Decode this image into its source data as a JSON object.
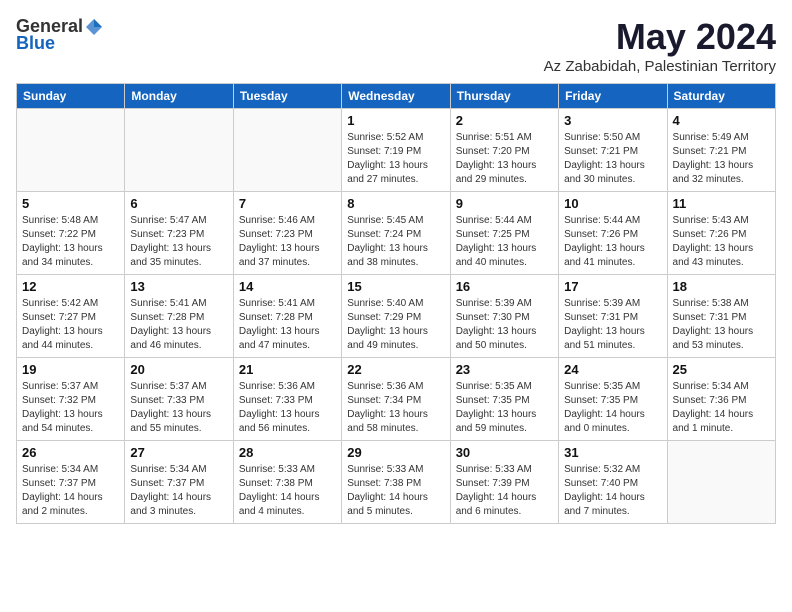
{
  "header": {
    "logo_general": "General",
    "logo_blue": "Blue",
    "month_title": "May 2024",
    "location": "Az Zababidah, Palestinian Territory"
  },
  "days_of_week": [
    "Sunday",
    "Monday",
    "Tuesday",
    "Wednesday",
    "Thursday",
    "Friday",
    "Saturday"
  ],
  "weeks": [
    [
      {
        "day": "",
        "info": ""
      },
      {
        "day": "",
        "info": ""
      },
      {
        "day": "",
        "info": ""
      },
      {
        "day": "1",
        "info": "Sunrise: 5:52 AM\nSunset: 7:19 PM\nDaylight: 13 hours\nand 27 minutes."
      },
      {
        "day": "2",
        "info": "Sunrise: 5:51 AM\nSunset: 7:20 PM\nDaylight: 13 hours\nand 29 minutes."
      },
      {
        "day": "3",
        "info": "Sunrise: 5:50 AM\nSunset: 7:21 PM\nDaylight: 13 hours\nand 30 minutes."
      },
      {
        "day": "4",
        "info": "Sunrise: 5:49 AM\nSunset: 7:21 PM\nDaylight: 13 hours\nand 32 minutes."
      }
    ],
    [
      {
        "day": "5",
        "info": "Sunrise: 5:48 AM\nSunset: 7:22 PM\nDaylight: 13 hours\nand 34 minutes."
      },
      {
        "day": "6",
        "info": "Sunrise: 5:47 AM\nSunset: 7:23 PM\nDaylight: 13 hours\nand 35 minutes."
      },
      {
        "day": "7",
        "info": "Sunrise: 5:46 AM\nSunset: 7:23 PM\nDaylight: 13 hours\nand 37 minutes."
      },
      {
        "day": "8",
        "info": "Sunrise: 5:45 AM\nSunset: 7:24 PM\nDaylight: 13 hours\nand 38 minutes."
      },
      {
        "day": "9",
        "info": "Sunrise: 5:44 AM\nSunset: 7:25 PM\nDaylight: 13 hours\nand 40 minutes."
      },
      {
        "day": "10",
        "info": "Sunrise: 5:44 AM\nSunset: 7:26 PM\nDaylight: 13 hours\nand 41 minutes."
      },
      {
        "day": "11",
        "info": "Sunrise: 5:43 AM\nSunset: 7:26 PM\nDaylight: 13 hours\nand 43 minutes."
      }
    ],
    [
      {
        "day": "12",
        "info": "Sunrise: 5:42 AM\nSunset: 7:27 PM\nDaylight: 13 hours\nand 44 minutes."
      },
      {
        "day": "13",
        "info": "Sunrise: 5:41 AM\nSunset: 7:28 PM\nDaylight: 13 hours\nand 46 minutes."
      },
      {
        "day": "14",
        "info": "Sunrise: 5:41 AM\nSunset: 7:28 PM\nDaylight: 13 hours\nand 47 minutes."
      },
      {
        "day": "15",
        "info": "Sunrise: 5:40 AM\nSunset: 7:29 PM\nDaylight: 13 hours\nand 49 minutes."
      },
      {
        "day": "16",
        "info": "Sunrise: 5:39 AM\nSunset: 7:30 PM\nDaylight: 13 hours\nand 50 minutes."
      },
      {
        "day": "17",
        "info": "Sunrise: 5:39 AM\nSunset: 7:31 PM\nDaylight: 13 hours\nand 51 minutes."
      },
      {
        "day": "18",
        "info": "Sunrise: 5:38 AM\nSunset: 7:31 PM\nDaylight: 13 hours\nand 53 minutes."
      }
    ],
    [
      {
        "day": "19",
        "info": "Sunrise: 5:37 AM\nSunset: 7:32 PM\nDaylight: 13 hours\nand 54 minutes."
      },
      {
        "day": "20",
        "info": "Sunrise: 5:37 AM\nSunset: 7:33 PM\nDaylight: 13 hours\nand 55 minutes."
      },
      {
        "day": "21",
        "info": "Sunrise: 5:36 AM\nSunset: 7:33 PM\nDaylight: 13 hours\nand 56 minutes."
      },
      {
        "day": "22",
        "info": "Sunrise: 5:36 AM\nSunset: 7:34 PM\nDaylight: 13 hours\nand 58 minutes."
      },
      {
        "day": "23",
        "info": "Sunrise: 5:35 AM\nSunset: 7:35 PM\nDaylight: 13 hours\nand 59 minutes."
      },
      {
        "day": "24",
        "info": "Sunrise: 5:35 AM\nSunset: 7:35 PM\nDaylight: 14 hours\nand 0 minutes."
      },
      {
        "day": "25",
        "info": "Sunrise: 5:34 AM\nSunset: 7:36 PM\nDaylight: 14 hours\nand 1 minute."
      }
    ],
    [
      {
        "day": "26",
        "info": "Sunrise: 5:34 AM\nSunset: 7:37 PM\nDaylight: 14 hours\nand 2 minutes."
      },
      {
        "day": "27",
        "info": "Sunrise: 5:34 AM\nSunset: 7:37 PM\nDaylight: 14 hours\nand 3 minutes."
      },
      {
        "day": "28",
        "info": "Sunrise: 5:33 AM\nSunset: 7:38 PM\nDaylight: 14 hours\nand 4 minutes."
      },
      {
        "day": "29",
        "info": "Sunrise: 5:33 AM\nSunset: 7:38 PM\nDaylight: 14 hours\nand 5 minutes."
      },
      {
        "day": "30",
        "info": "Sunrise: 5:33 AM\nSunset: 7:39 PM\nDaylight: 14 hours\nand 6 minutes."
      },
      {
        "day": "31",
        "info": "Sunrise: 5:32 AM\nSunset: 7:40 PM\nDaylight: 14 hours\nand 7 minutes."
      },
      {
        "day": "",
        "info": ""
      }
    ]
  ]
}
